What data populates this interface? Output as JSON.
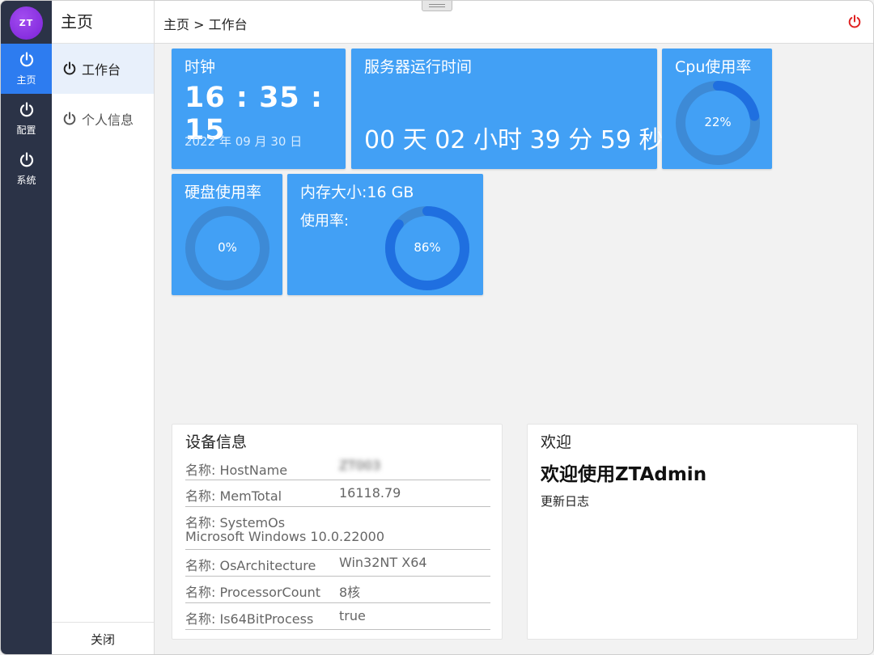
{
  "logo": {
    "text": "ZT"
  },
  "rail": [
    {
      "label": "主页",
      "icon": "power-icon",
      "active": true
    },
    {
      "label": "配置",
      "icon": "power-icon",
      "active": false
    },
    {
      "label": "系统",
      "icon": "power-icon",
      "active": false
    }
  ],
  "submenu": {
    "title": "主页",
    "items": [
      {
        "label": "工作台",
        "active": true
      },
      {
        "label": "个人信息",
        "active": false
      }
    ],
    "close_label": "关闭"
  },
  "topbar": {
    "breadcrumb": "主页 > 工作台",
    "logout_icon": "power-icon",
    "logout_color": "#e02020"
  },
  "tiles": {
    "clock": {
      "title": "时钟",
      "time": "16 : 35 : 15",
      "date": "2022 年 09 月 30 日"
    },
    "uptime": {
      "title": "服务器运行时间",
      "value": "00 天 02 小时 39 分 59 秒"
    },
    "cpu": {
      "title": "Cpu使用率",
      "percent": 22,
      "label": "22%"
    },
    "disk": {
      "title": "硬盘使用率",
      "percent": 0,
      "label": "0%"
    },
    "memory": {
      "title": "内存大小:16 GB",
      "sub": "使用率:",
      "percent": 86,
      "label": "86%"
    }
  },
  "colors": {
    "tile": "#42a0f5",
    "ring_track": "#3d8ad6",
    "ring_fill": "#1f6fe0",
    "rail": "#2b3347",
    "accent": "#2d7cf0"
  },
  "device_info": {
    "title": "设备信息",
    "rows": [
      {
        "key": "名称: HostName",
        "value": "ZT003"
      },
      {
        "key": "名称: MemTotal",
        "value": "16118.79"
      },
      {
        "key": "名称: SystemOs",
        "value": "Microsoft Windows 10.0.22000"
      },
      {
        "key": "名称: OsArchitecture",
        "value": "Win32NT X64"
      },
      {
        "key": "名称: ProcessorCount",
        "value": "8核"
      },
      {
        "key": "名称: Is64BitProcess",
        "value": "true"
      }
    ]
  },
  "welcome": {
    "title": "欢迎",
    "headline": "欢迎使用ZTAdmin",
    "link": "更新日志"
  }
}
